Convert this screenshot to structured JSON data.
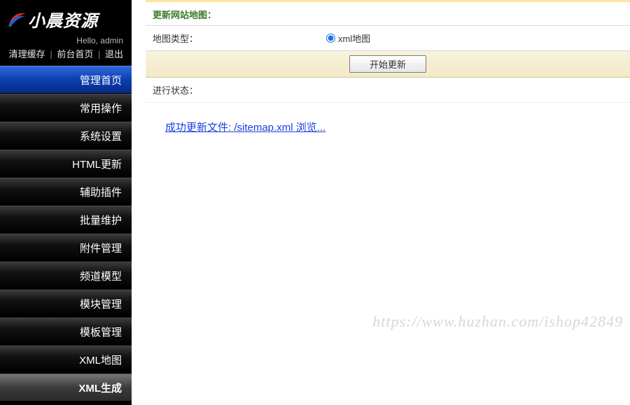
{
  "brand": {
    "name": "小晨资源"
  },
  "user": {
    "greet": "Hello, admin"
  },
  "quicklinks": {
    "clear_cache": "清理缓存",
    "front_home": "前台首页",
    "logout": "退出"
  },
  "sidebar": {
    "items": [
      {
        "label": "管理首页",
        "style": "blue"
      },
      {
        "label": "常用操作",
        "style": "dark"
      },
      {
        "label": "系统设置",
        "style": "dark"
      },
      {
        "label": "HTML更新",
        "style": "dark"
      },
      {
        "label": "辅助插件",
        "style": "dark"
      },
      {
        "label": "批量维护",
        "style": "dark"
      },
      {
        "label": "附件管理",
        "style": "dark"
      },
      {
        "label": "频道模型",
        "style": "dark"
      },
      {
        "label": "模块管理",
        "style": "dark"
      },
      {
        "label": "模板管理",
        "style": "dark"
      },
      {
        "label": "XML地图",
        "style": "dark"
      },
      {
        "label": "XML生成",
        "style": "active"
      }
    ]
  },
  "panel": {
    "title": "更新网站地图：",
    "map_type_label": "地图类型：",
    "map_type_option": "xml地图",
    "start_button": "开始更新",
    "status_label": "进行状态：",
    "result_link": "成功更新文件: /sitemap.xml 浏览..."
  },
  "watermark": "https://www.huzhan.com/ishop42849"
}
